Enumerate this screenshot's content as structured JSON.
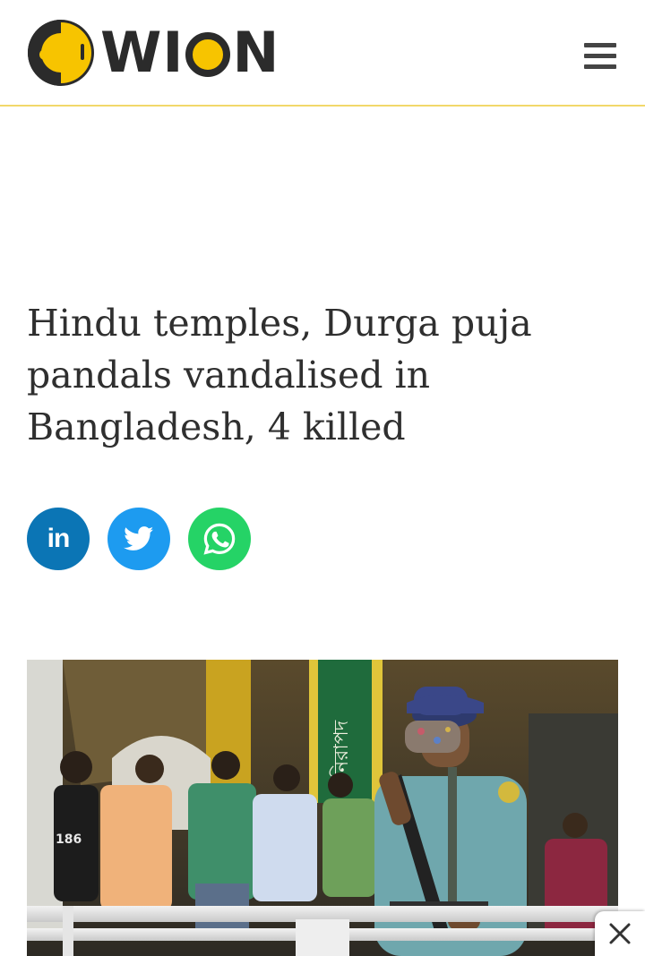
{
  "brand": {
    "name": "WION",
    "text_left": "W",
    "text_i": "I",
    "text_right": "N",
    "accent": "#f7c400",
    "dark": "#2b2b2b"
  },
  "header": {
    "menu_icon": "hamburger-menu-icon"
  },
  "article": {
    "headline": "Hindu temples, Durga puja pandals vandalised in Bangladesh, 4 killed",
    "share": [
      {
        "network": "linkedin",
        "icon": "linkedin-icon",
        "label": "in",
        "color": "#0b75b5"
      },
      {
        "network": "twitter",
        "icon": "twitter-icon",
        "color": "#1d9bf0"
      },
      {
        "network": "whatsapp",
        "icon": "whatsapp-icon",
        "color": "#25d366"
      }
    ],
    "photo": {
      "subject": "armed police officer wearing a face mask guarding a street with people in the background",
      "banner_text": "নিরাপদ",
      "shirt_number": "186"
    }
  },
  "ad": {
    "close_icon": "close-icon"
  }
}
